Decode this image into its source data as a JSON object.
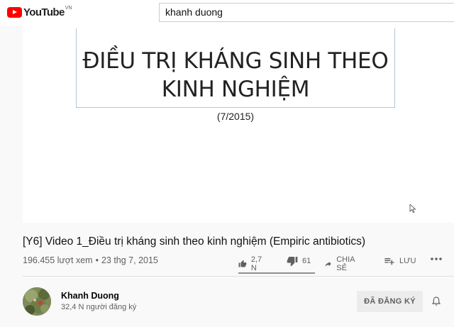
{
  "header": {
    "logo_text": "YouTube",
    "logo_country": "VN",
    "search_value": "khanh duong"
  },
  "player": {
    "slide_title_line1": "ĐIỀU TRỊ KHÁNG SINH THEO",
    "slide_title_line2": "KINH NGHIỆM",
    "slide_subtitle": "(7/2015)"
  },
  "video": {
    "title": "[Y6] Video 1_Điều trị kháng sinh theo kinh nghiệm (Empiric antibiotics)",
    "views": "196.455 lượt xem",
    "separator": "•",
    "date": "23 thg 7, 2015",
    "like_count": "2,7 N",
    "dislike_count": "61",
    "share_label": "CHIA SẺ",
    "save_label": "LƯU",
    "like_ratio": 0.978
  },
  "channel": {
    "name": "Khanh Duong",
    "subscribers": "32,4 N người đăng ký",
    "subscribe_label": "ĐÃ ĐĂNG KÝ"
  },
  "icons": {
    "like": "thumbs-up-icon",
    "dislike": "thumbs-down-icon",
    "share": "share-arrow-icon",
    "save": "playlist-add-icon",
    "more": "more-horizontal-icon",
    "bell": "bell-icon"
  },
  "colors": {
    "brand_red": "#ff0000",
    "background": "#f9f9f9",
    "secondary_text": "#606060"
  }
}
